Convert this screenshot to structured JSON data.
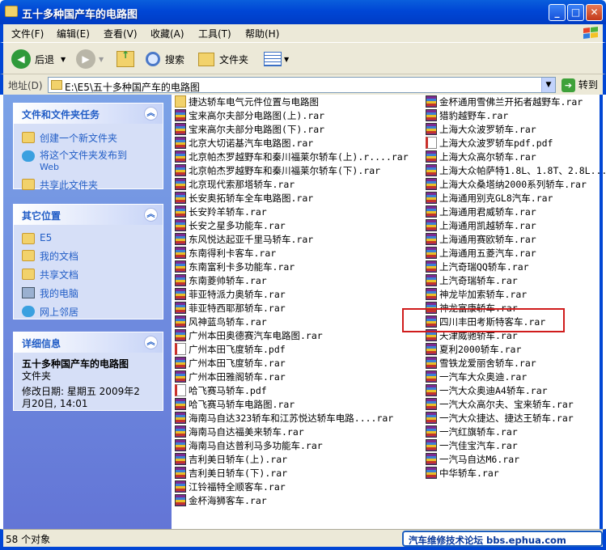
{
  "window": {
    "title": "五十多种国产车的电路图",
    "buttons": {
      "minimize": "_",
      "maximize": "□",
      "close": "✕"
    }
  },
  "menubar": {
    "items": [
      "文件(F)",
      "编辑(E)",
      "查看(V)",
      "收藏(A)",
      "工具(T)",
      "帮助(H)"
    ]
  },
  "toolbar": {
    "back_label": "后退",
    "search_label": "搜索",
    "folders_label": "文件夹"
  },
  "address": {
    "label": "地址(D)",
    "value": "E:\\E5\\五十多种国产车的电路图",
    "go_label": "转到"
  },
  "tasks_panel": {
    "title": "文件和文件夹任务",
    "items": [
      "创建一个新文件夹",
      "将这个文件夹发布到",
      "Web",
      "共享此文件夹"
    ]
  },
  "places_panel": {
    "title": "其它位置",
    "items": [
      "E5",
      "我的文档",
      "共享文档",
      "我的电脑",
      "网上邻居"
    ]
  },
  "details_panel": {
    "title": "详细信息",
    "name": "五十多种国产车的电路图",
    "type": "文件夹",
    "modified_line1": "修改日期: 星期五 2009年2",
    "modified_line2": "月20日, 14:01"
  },
  "files_col1": [
    {
      "name": "捷达轿车电气元件位置与电路图",
      "type": "folder"
    },
    {
      "name": "宝来高尔夫部分电路图(上).rar",
      "type": "rar"
    },
    {
      "name": "宝来高尔夫部分电路图(下).rar",
      "type": "rar"
    },
    {
      "name": "北京大切诺基汽车电路图.rar",
      "type": "rar"
    },
    {
      "name": "北京帕杰罗越野车和秦川福莱尔轿车(上).r....rar",
      "type": "rar"
    },
    {
      "name": "北京帕杰罗越野车和秦川福莱尔轿车(下).rar",
      "type": "rar"
    },
    {
      "name": "北京现代索那塔轿车.rar",
      "type": "rar"
    },
    {
      "name": "长安奥拓轿车全车电路图.rar",
      "type": "rar"
    },
    {
      "name": "长安羚羊轿车.rar",
      "type": "rar"
    },
    {
      "name": "长安之星多功能车.rar",
      "type": "rar"
    },
    {
      "name": "东风悦达起亚千里马轿车.rar",
      "type": "rar"
    },
    {
      "name": "东南得利卡客车.rar",
      "type": "rar"
    },
    {
      "name": "东南富利卡多功能车.rar",
      "type": "rar"
    },
    {
      "name": "东南菱帅轿车.rar",
      "type": "rar"
    },
    {
      "name": "菲亚特派力奥轿车.rar",
      "type": "rar"
    },
    {
      "name": "菲亚特西耶那轿车.rar",
      "type": "rar"
    },
    {
      "name": "风神蓝鸟轿车.rar",
      "type": "rar"
    },
    {
      "name": "广州本田奥德赛汽车电路图.rar",
      "type": "rar"
    },
    {
      "name": "广州本田飞度轿车.pdf",
      "type": "pdf"
    },
    {
      "name": "广州本田飞度轿车.rar",
      "type": "rar"
    },
    {
      "name": "广州本田雅阁轿车.rar",
      "type": "rar"
    },
    {
      "name": "哈飞赛马轿车.pdf",
      "type": "pdf"
    },
    {
      "name": "哈飞赛马轿车电路图.rar",
      "type": "rar"
    },
    {
      "name": "海南马自达323轿车和江苏悦达轿车电路....rar",
      "type": "rar"
    },
    {
      "name": "海南马自达福美来轿车.rar",
      "type": "rar"
    },
    {
      "name": "海南马自达普利马多功能车.rar",
      "type": "rar"
    },
    {
      "name": "吉利美日轿车(上).rar",
      "type": "rar"
    },
    {
      "name": "吉利美日轿车(下).rar",
      "type": "rar"
    },
    {
      "name": "江铃福特全顺客车.rar",
      "type": "rar"
    },
    {
      "name": "金杯海狮客车.rar",
      "type": "rar"
    }
  ],
  "files_col2": [
    {
      "name": "金杯通用雪佛兰开拓者越野车.rar",
      "type": "rar"
    },
    {
      "name": "猎豹越野车.rar",
      "type": "rar"
    },
    {
      "name": "上海大众波罗轿车.rar",
      "type": "rar"
    },
    {
      "name": "上海大众波罗轿车pdf.pdf",
      "type": "pdf"
    },
    {
      "name": "上海大众高尔轿车.rar",
      "type": "rar"
    },
    {
      "name": "上海大众帕萨特1.8L、1.8T、2.8L...",
      "type": "rar"
    },
    {
      "name": "上海大众桑塔纳2000系列轿车.rar",
      "type": "rar"
    },
    {
      "name": "上海通用别克GL8汽车.rar",
      "type": "rar"
    },
    {
      "name": "上海通用君威轿车.rar",
      "type": "rar"
    },
    {
      "name": "上海通用凯越轿车.rar",
      "type": "rar"
    },
    {
      "name": "上海通用赛欧轿车.rar",
      "type": "rar"
    },
    {
      "name": "上海通用五菱汽车.rar",
      "type": "rar"
    },
    {
      "name": "上汽奇瑞QQ轿车.rar",
      "type": "rar"
    },
    {
      "name": "上汽奇瑞轿车.rar",
      "type": "rar"
    },
    {
      "name": "神龙毕加索轿车.rar",
      "type": "rar"
    },
    {
      "name": "神龙富康轿车.rar",
      "type": "rar"
    },
    {
      "name": "四川丰田考斯特客车.rar",
      "type": "rar"
    },
    {
      "name": "天津威驰轿车.rar",
      "type": "rar"
    },
    {
      "name": "夏利2000轿车.rar",
      "type": "rar"
    },
    {
      "name": "雪铁龙爱丽舍轿车.rar",
      "type": "rar"
    },
    {
      "name": "一汽车大众奥迪.rar",
      "type": "rar"
    },
    {
      "name": "一汽大众奥迪A4轿车.rar",
      "type": "rar"
    },
    {
      "name": "一汽大众高尔夫、宝来轿车.rar",
      "type": "rar"
    },
    {
      "name": "一汽大众捷达、捷达王轿车.rar",
      "type": "rar"
    },
    {
      "name": "一汽红旗轿车.rar",
      "type": "rar"
    },
    {
      "name": "一汽佳宝汽车.rar",
      "type": "rar"
    },
    {
      "name": "一汽马自达M6.rar",
      "type": "rar"
    },
    {
      "name": "中华轿车.rar",
      "type": "rar"
    }
  ],
  "statusbar": {
    "count": "58 个对象",
    "watermark": "汽车维修技术论坛 bbs.ephua.com"
  }
}
